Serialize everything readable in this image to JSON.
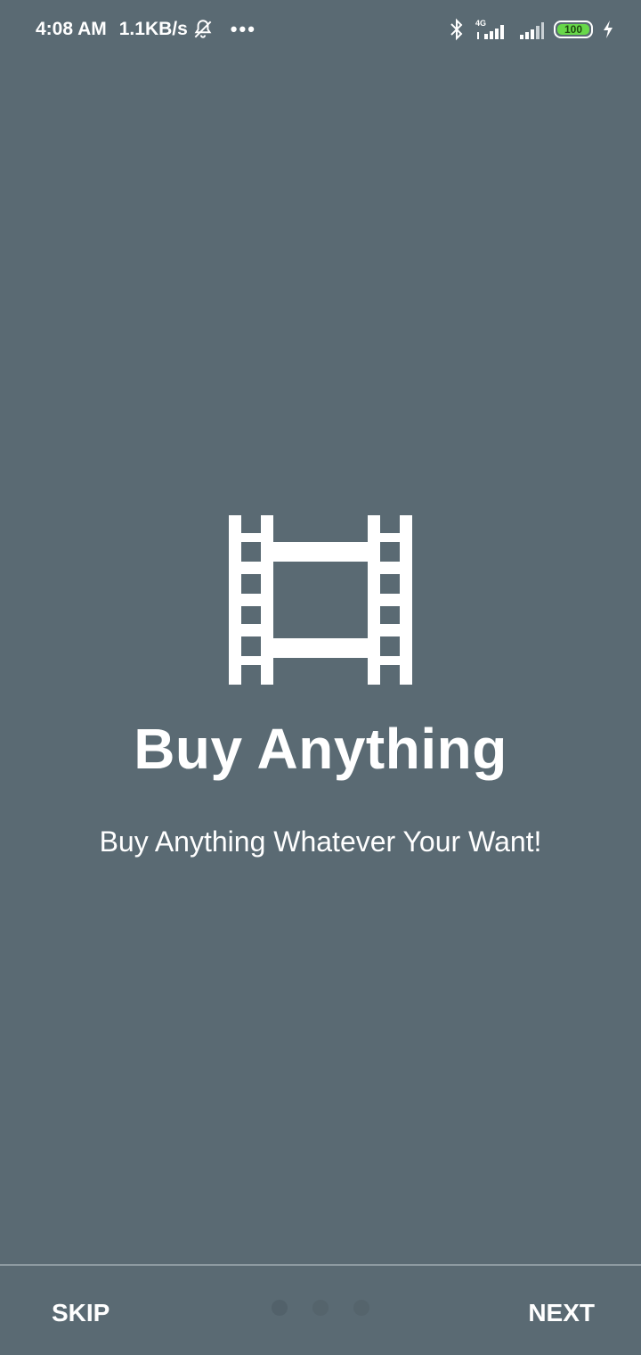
{
  "status_bar": {
    "time": "4:08 AM",
    "network_speed": "1.1KB/s",
    "more": "•••",
    "network_type": "4G",
    "battery": "100"
  },
  "onboarding": {
    "icon": "film-icon",
    "title": "Buy Anything",
    "subtitle": "Buy Anything Whatever Your Want!",
    "page_count": 3,
    "current_page": 1
  },
  "bottom_bar": {
    "skip_label": "SKIP",
    "next_label": "NEXT"
  },
  "colors": {
    "background": "#5a6a73",
    "text": "#ffffff",
    "battery": "#68d84a"
  }
}
